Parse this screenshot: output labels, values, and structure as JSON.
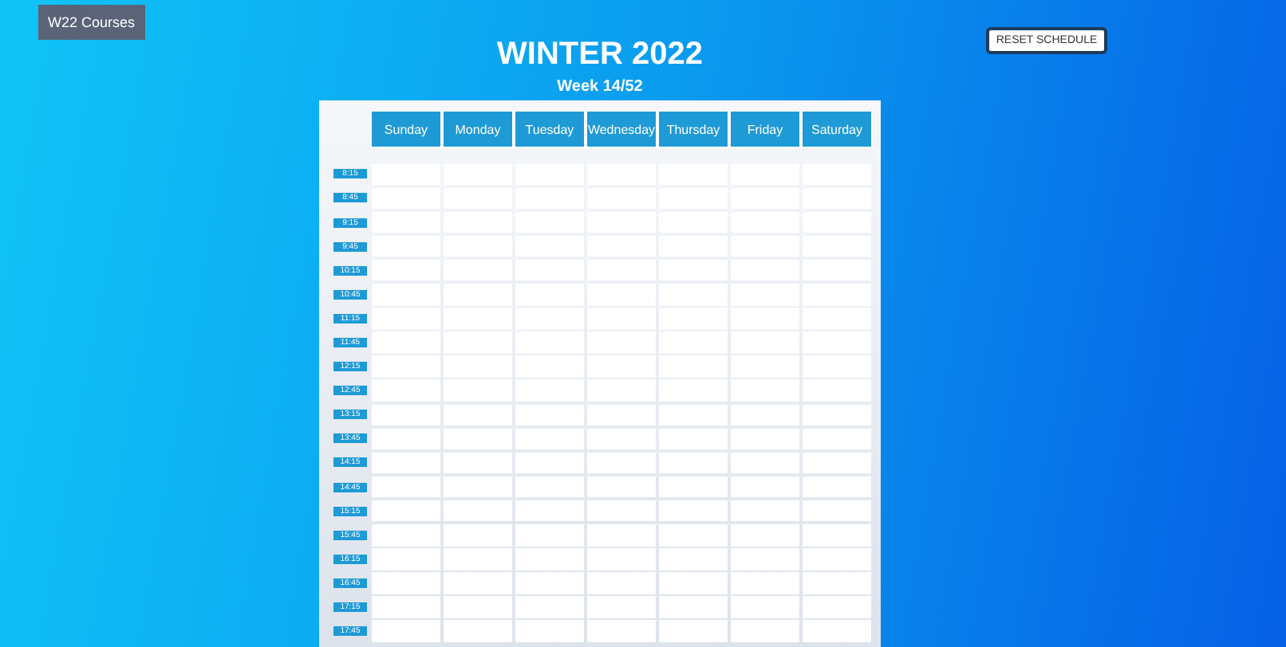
{
  "courses_button": {
    "label": "W22 Courses"
  },
  "term_title": "WINTER 2022",
  "week": "Week 14/52",
  "reset_button": {
    "label": "RESET SCHEDULE"
  },
  "days": [
    "Sunday",
    "Monday",
    "Tuesday",
    "Wednesday",
    "Thursday",
    "Friday",
    "Saturday"
  ],
  "times": [
    "8:15",
    "8:45",
    "9:15",
    "9:45",
    "10:15",
    "10:45",
    "11:15",
    "11:45",
    "12:15",
    "12:45",
    "13:15",
    "13:45",
    "14:15",
    "14:45",
    "15:15",
    "15:45",
    "16:15",
    "16:45",
    "17:15",
    "17:45"
  ]
}
